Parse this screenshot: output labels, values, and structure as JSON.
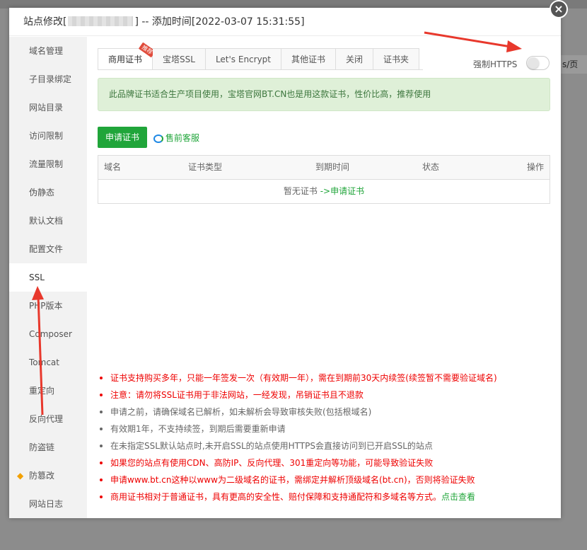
{
  "background": {
    "right_hint": "s/页"
  },
  "dialog": {
    "title_prefix": "站点修改[",
    "title_suffix": "] -- 添加时间[2022-03-07 15:31:55]",
    "close_icon": "×"
  },
  "sidebar": {
    "items": [
      {
        "label": "域名管理"
      },
      {
        "label": "子目录绑定"
      },
      {
        "label": "网站目录"
      },
      {
        "label": "访问限制"
      },
      {
        "label": "流量限制"
      },
      {
        "label": "伪静态"
      },
      {
        "label": "默认文档"
      },
      {
        "label": "配置文件"
      },
      {
        "label": "SSL"
      },
      {
        "label": "PHP版本"
      },
      {
        "label": "Composer"
      },
      {
        "label": "Tomcat"
      },
      {
        "label": "重定向"
      },
      {
        "label": "反向代理"
      },
      {
        "label": "防盗链"
      },
      {
        "label": "防篡改"
      },
      {
        "label": "网站日志"
      }
    ],
    "active": "SSL",
    "gem_icon": "◆"
  },
  "tabs": {
    "items": [
      {
        "label": "商用证书",
        "ribbon": "推荐"
      },
      {
        "label": "宝塔SSL"
      },
      {
        "label": "Let's Encrypt"
      },
      {
        "label": "其他证书"
      },
      {
        "label": "关闭"
      },
      {
        "label": "证书夹"
      }
    ]
  },
  "force_https": {
    "label": "强制HTTPS",
    "enabled": false
  },
  "notice": "此品牌证书适合生产项目使用，宝塔官网BT.CN也是用这款证书，性价比高，推荐使用",
  "actions": {
    "apply": "申请证书",
    "presale": "售前客服"
  },
  "table": {
    "headers": [
      "域名",
      "证书类型",
      "到期时间",
      "状态",
      "操作"
    ],
    "empty_text": "暂无证书",
    "empty_link": "->申请证书"
  },
  "tips": [
    {
      "text": "证书支持购买多年，只能一年签发一次（有效期一年），需在到期前30天内续签(续签暂不需要验证域名)",
      "color": "red"
    },
    {
      "text": "注意：请勿将SSL证书用于非法网站，一经发现，吊销证书且不退款",
      "color": "red"
    },
    {
      "text": "申请之前，请确保域名已解析，如未解析会导致审核失败(包括根域名)",
      "color": "gray"
    },
    {
      "text": "有效期1年，不支持续签，到期后需要重新申请",
      "color": "gray"
    },
    {
      "text": "在未指定SSL默认站点时,未开启SSL的站点使用HTTPS会直接访问到已开启SSL的站点",
      "color": "gray"
    },
    {
      "text": "如果您的站点有使用CDN、高防IP、反向代理、301重定向等功能，可能导致验证失败",
      "color": "red"
    },
    {
      "text": "申请www.bt.cn这种以www为二级域名的证书，需绑定并解析顶级域名(bt.cn)，否则将验证失败",
      "color": "red"
    },
    {
      "text": "商用证书相对于普通证书，具有更高的安全性、赔付保障和支持通配符和多域名等方式。",
      "color": "red",
      "link": "点击查看"
    }
  ],
  "colors": {
    "accent": "#20a53a",
    "danger": "#e00000",
    "arrow": "#e8382c"
  }
}
